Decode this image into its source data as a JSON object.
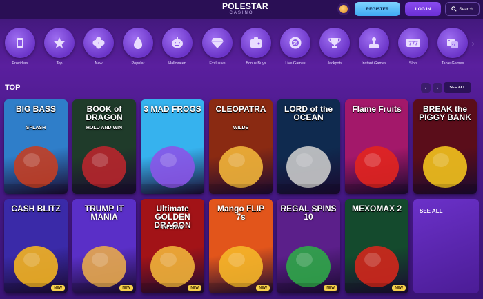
{
  "header": {
    "logo_main": "POLESTAR",
    "logo_sub": "CASINO",
    "register_label": "REGISTER",
    "login_label": "LOG IN",
    "search_label": "Search"
  },
  "categories": [
    {
      "label": "Providers",
      "icon": "cards-icon"
    },
    {
      "label": "Top",
      "icon": "star-icon"
    },
    {
      "label": "New",
      "icon": "flower-icon"
    },
    {
      "label": "Popular",
      "icon": "flame-icon"
    },
    {
      "label": "Halloween",
      "icon": "pumpkin-icon"
    },
    {
      "label": "Exclusive",
      "icon": "diamond-icon"
    },
    {
      "label": "Bonus Buys",
      "icon": "wallet-icon"
    },
    {
      "label": "Live Games",
      "icon": "chip-icon"
    },
    {
      "label": "Jackpots",
      "icon": "trophy-icon"
    },
    {
      "label": "Instant Games",
      "icon": "joystick-icon"
    },
    {
      "label": "Slots",
      "icon": "slot-icon"
    },
    {
      "label": "Table Games",
      "icon": "dice-icon"
    }
  ],
  "section": {
    "title": "TOP",
    "see_all_label": "SEE ALL",
    "prev_icon": "chevron-left-icon",
    "next_icon": "chevron-right-icon"
  },
  "games": [
    {
      "title": "BIG BASS",
      "subtitle": "SPLASH",
      "new": false,
      "bg": "#2f7ec9",
      "accent": "#c33e23"
    },
    {
      "title": "BOOK of DRAGON",
      "subtitle": "HOLD AND WIN",
      "new": false,
      "bg": "#1f3b2a",
      "accent": "#b8262c"
    },
    {
      "title": "3 MAD FROGS",
      "subtitle": "",
      "new": false,
      "bg": "#36b2ee",
      "accent": "#8a55e8"
    },
    {
      "title": "CLEOPATRA",
      "subtitle": "WILDS",
      "new": false,
      "bg": "#8a2a12",
      "accent": "#f0b43a"
    },
    {
      "title": "LORD of the OCEAN",
      "subtitle": "",
      "new": false,
      "bg": "#0f2a4f",
      "accent": "#c9c9c9"
    },
    {
      "title": "Flame Fruits",
      "subtitle": "",
      "new": false,
      "bg": "#a3186a",
      "accent": "#e2251f"
    },
    {
      "title": "BREAK the PIGGY BANK",
      "subtitle": "",
      "new": false,
      "bg": "#5a0d1a",
      "accent": "#f2c21d"
    },
    {
      "title": "CASH BLITZ",
      "subtitle": "",
      "new": true,
      "bg": "#3a2aa8",
      "accent": "#f3b320"
    },
    {
      "title": "TRUMP IT MANIA",
      "subtitle": "",
      "new": true,
      "bg": "#5a2fc7",
      "accent": "#e7a94c"
    },
    {
      "title": "Ultimate GOLDEN DRAGON",
      "subtitle": "INFERNO",
      "new": true,
      "bg": "#a21317",
      "accent": "#f0b23a"
    },
    {
      "title": "Mango FLIP 7s",
      "subtitle": "",
      "new": true,
      "bg": "#e2551b",
      "accent": "#f5b629"
    },
    {
      "title": "REGAL SPINS 10",
      "subtitle": "",
      "new": true,
      "bg": "#5b1f8a",
      "accent": "#2fa748"
    },
    {
      "title": "MEXOMAX 2",
      "subtitle": "",
      "new": true,
      "bg": "#144a2d",
      "accent": "#d2271c"
    }
  ],
  "see_all_tile_label": "SEE ALL",
  "new_badge": "NEW"
}
